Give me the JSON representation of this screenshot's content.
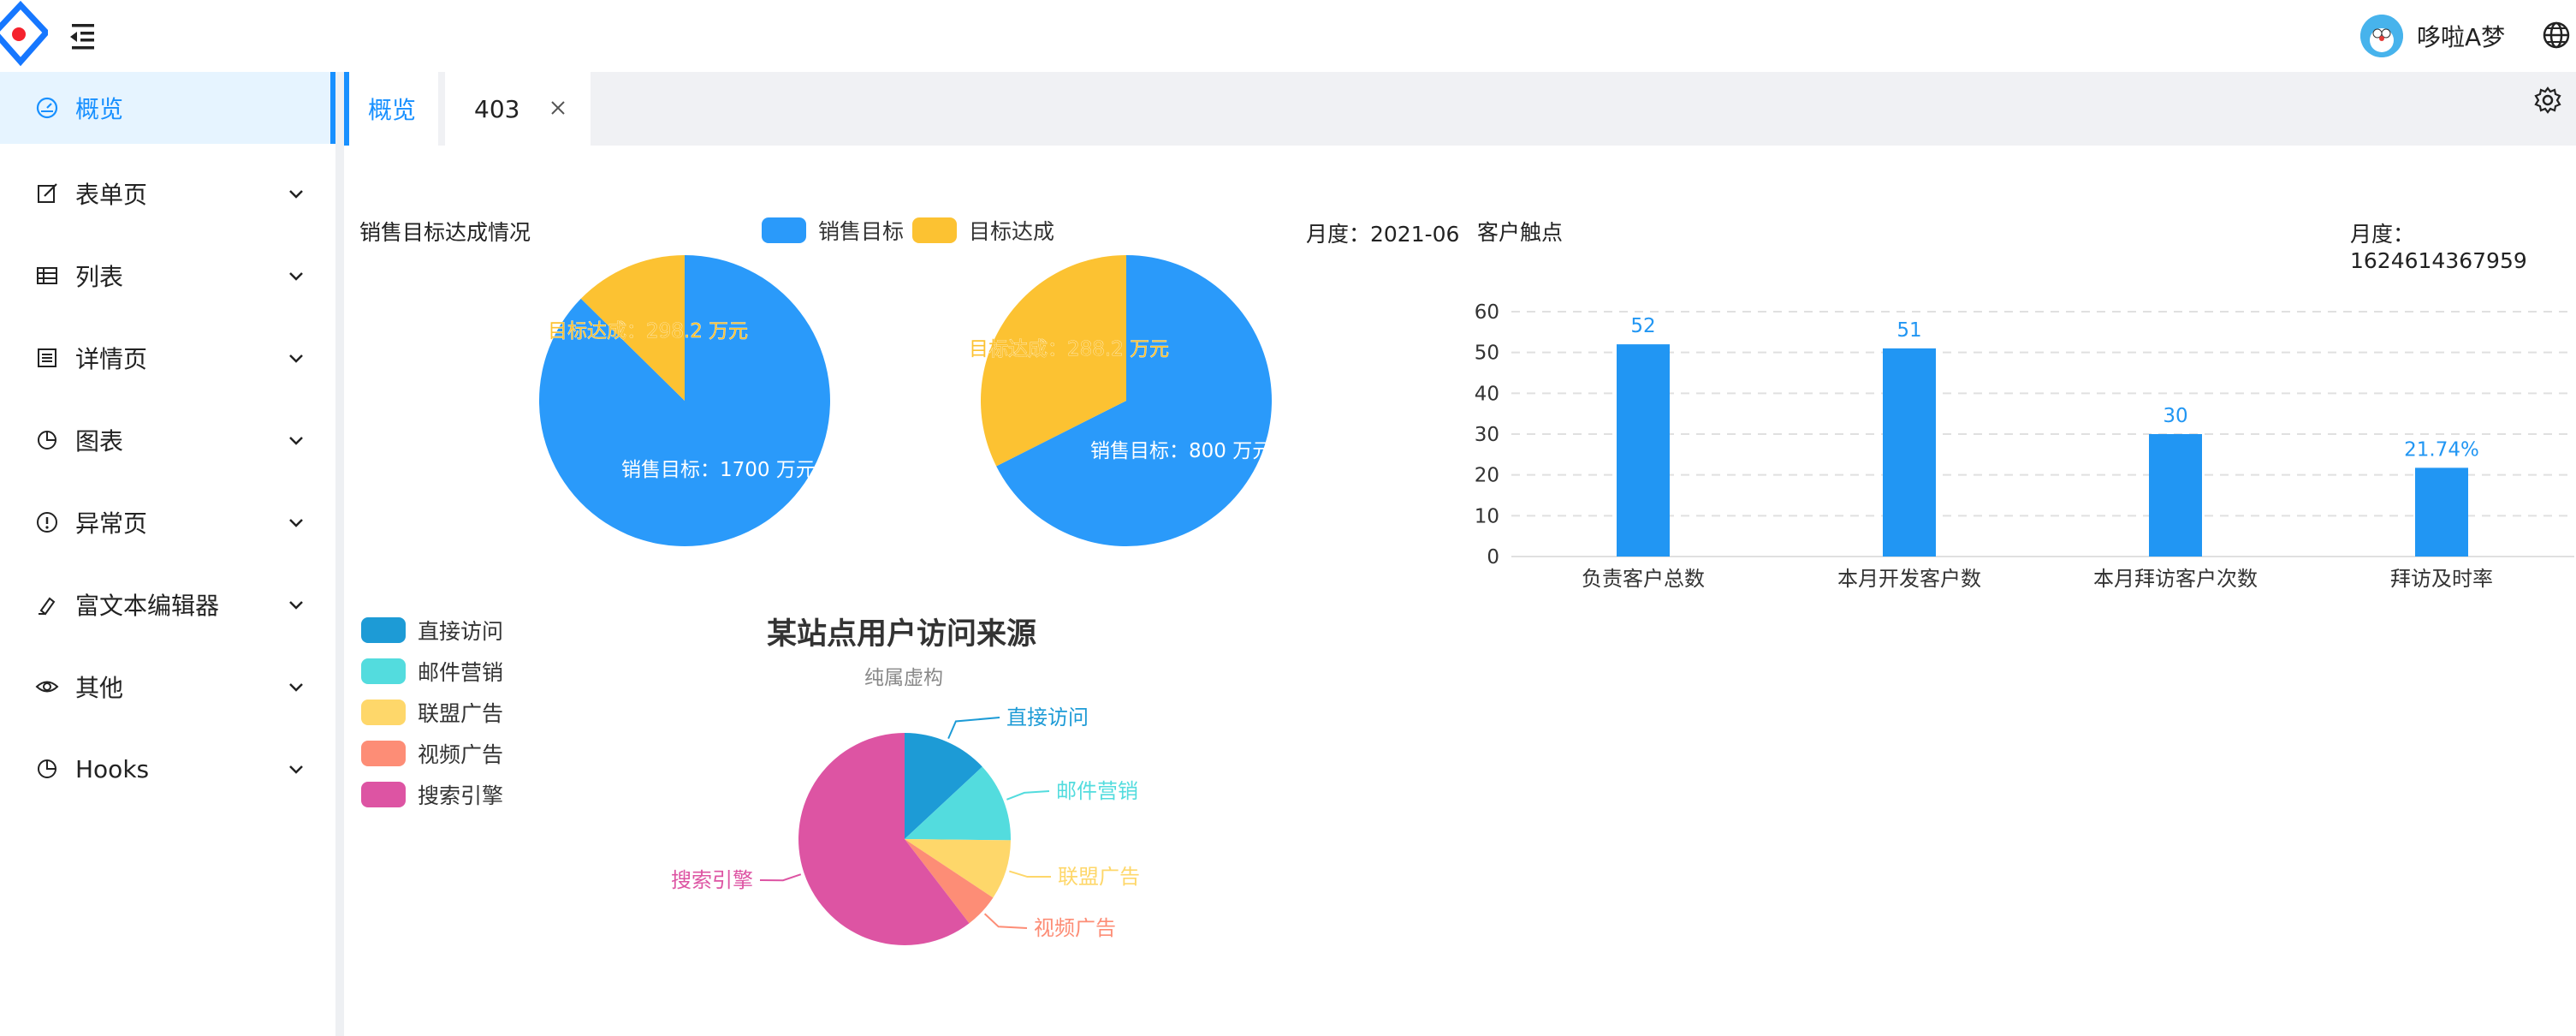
{
  "header": {
    "user_name": "哆啦A梦"
  },
  "sidebar": {
    "items": [
      {
        "label": "概览",
        "icon": "dashboard-icon",
        "active": true
      },
      {
        "label": "表单页",
        "icon": "form-icon"
      },
      {
        "label": "列表",
        "icon": "table-icon"
      },
      {
        "label": "详情页",
        "icon": "profile-icon"
      },
      {
        "label": "图表",
        "icon": "pie-chart-icon"
      },
      {
        "label": "异常页",
        "icon": "exclamation-icon"
      },
      {
        "label": "富文本编辑器",
        "icon": "highlight-icon"
      },
      {
        "label": "其他",
        "icon": "eye-icon"
      },
      {
        "label": "Hooks",
        "icon": "pie-chart-icon"
      }
    ]
  },
  "tabs": [
    {
      "label": "概览",
      "active": true
    },
    {
      "label": "403",
      "closable": true
    }
  ],
  "colors": {
    "accent": "#1890ff",
    "target": "#2a9afa",
    "achieved": "#fcc232",
    "bar": "#2196f3"
  },
  "sales": {
    "title": "销售目标达成情况",
    "month": "月度：2021-06",
    "legend": [
      "销售目标",
      "目标达成"
    ]
  },
  "customer": {
    "title": "客户触点",
    "month": "月度：1624614367959"
  },
  "traffic": {
    "title": "某站点用户访问来源",
    "subtitle": "纯属虚构",
    "legend": [
      "直接访问",
      "邮件营销",
      "联盟广告",
      "视频广告",
      "搜索引擎"
    ]
  },
  "chart_data": [
    {
      "type": "pie",
      "name": "pie-1",
      "slices": [
        {
          "label": "销售目标",
          "value": 1700,
          "text": "销售目标：1700 万元",
          "color": "#2a9afa"
        },
        {
          "label": "目标达成",
          "value": 298.2,
          "text": "目标达成：298.2 万元",
          "color": "#fcc232"
        }
      ]
    },
    {
      "type": "pie",
      "name": "pie-2",
      "slices": [
        {
          "label": "销售目标",
          "value": 800,
          "text": "销售目标：800 万元",
          "color": "#2a9afa"
        },
        {
          "label": "目标达成",
          "value": 288.2,
          "text": "目标达成：288.2 万元",
          "color": "#fcc232"
        }
      ]
    },
    {
      "type": "bar",
      "name": "customer-bars",
      "categories": [
        "负责客户总数",
        "本月开发客户数",
        "本月拜访客户次数",
        "拜访及时率"
      ],
      "values": [
        52,
        51,
        30,
        21.74
      ],
      "data_labels": [
        "52",
        "51",
        "30",
        "21.74%"
      ],
      "ylim": [
        0,
        60
      ],
      "yticks": [
        0,
        10,
        20,
        30,
        40,
        50,
        60
      ],
      "grid": true
    },
    {
      "type": "pie",
      "name": "traffic-pie",
      "title": "某站点用户访问来源",
      "subtitle": "纯属虚构",
      "slices": [
        {
          "label": "直接访问",
          "value": 335,
          "color": "#1d9bd6"
        },
        {
          "label": "邮件营销",
          "value": 310,
          "color": "#53dcde"
        },
        {
          "label": "联盟广告",
          "value": 234,
          "color": "#fed76a"
        },
        {
          "label": "视频广告",
          "value": 135,
          "color": "#fd8d76"
        },
        {
          "label": "搜索引擎",
          "value": 1548,
          "color": "#dd54a3"
        }
      ],
      "legend_placement": "left"
    }
  ]
}
